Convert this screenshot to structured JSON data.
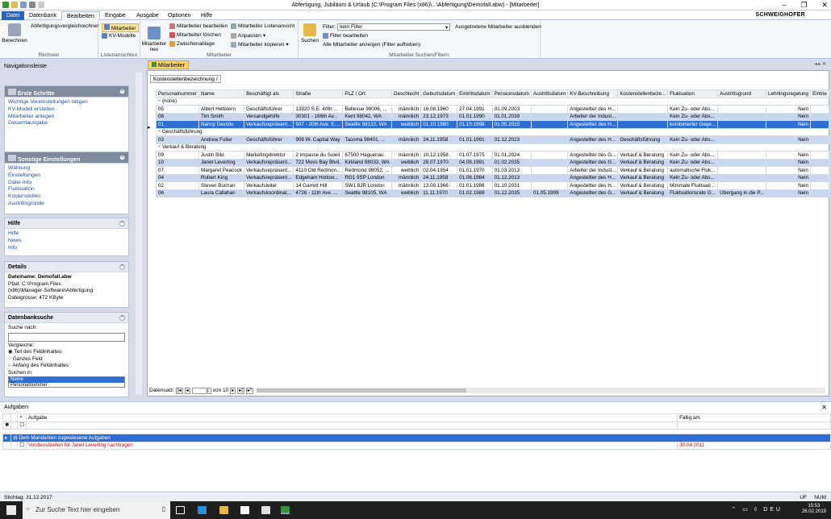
{
  "window": {
    "title": "Abfertigung, Jubiläum & Urlaub (C:\\Program Files (x86)\\...\\Abfertigung\\Demofall.abw) - [Mitarbeiter]",
    "brand": "SCHWEIGHOFER"
  },
  "menu": {
    "file": "Datei",
    "tabs": [
      "Datenbank",
      "Bearbeiten",
      "Eingabe",
      "Ausgabe",
      "Optionen",
      "Hilfe"
    ]
  },
  "ribbon": {
    "rechnen": {
      "abf": "Abfertigungsvergleichrechner",
      "btn": "Berechnen",
      "label": "Rechnen"
    },
    "listen": {
      "mitarbeiter": "Mitarbeiter",
      "kv": "KV-Modelle",
      "label": "Listenansichten"
    },
    "mitarbeiter": {
      "neu": "Mitarbeiter neu",
      "bearbeiten": "Mitarbeiter bearbeiten",
      "loeschen": "Mitarbeiter löschen",
      "zwischen": "Zwischenablage",
      "listenansicht": "Mitarbeiter Listenansicht",
      "anpassen": "Anpassen",
      "kopieren": "Mitarbeiter kopieren",
      "label": "Mitarbeiter"
    },
    "suchen": {
      "btn": "Suchen",
      "filter_label": "Filter:",
      "filter_value": "kein Filter",
      "ausblenden": "Ausgetretene Mitarbeiter ausblenden",
      "bearbeiten": "Filter bearbeiten",
      "alle": "Alle Mitarbeiter anzeigen (Filter aufheben)",
      "label": "Mitarbeiter Suchen/Filtern"
    }
  },
  "sidebar": {
    "title": "Navigationsleiste",
    "erste": {
      "title": "Erste Schritte",
      "links": [
        "Wichtige Voreinstellungen tätigen",
        "KV-Modell erstellen",
        "Mitarbeiter anlegen",
        "Gesamtausgabe"
      ]
    },
    "sonstige": {
      "title": "Sonstige Einstellungen",
      "links": [
        "Währung",
        "Einstellungen",
        "Datei-Info",
        "Fluktuation",
        "Kostenstellen",
        "Austrittsgründe"
      ]
    },
    "hilfe": {
      "title": "Hilfe",
      "links": [
        "Hilfe",
        "News",
        "Info"
      ]
    },
    "details": {
      "title": "Details",
      "name": "Dateiname: Demofall.abw",
      "pfad1": "Pfad: C:\\Program Files",
      "pfad2": "(x86)\\Manager-Software\\Abfertigung",
      "groesse": "Dateigrösse: 472 KByte"
    },
    "suche": {
      "title": "Datenbanksuche",
      "nach": "Suche nach:",
      "in_label": "Vergleiche:",
      "opt1": "Teil des Feldinhaltes",
      "opt2": "Ganzes Feld",
      "opt3": "Anfang des Feldinhaltes",
      "suchenin": "Suchen in:",
      "list1": "Name",
      "list2": "Personalnummer"
    }
  },
  "main": {
    "tab": "Mitarbeiter",
    "group_by": "Kostenstellenbezeichnung",
    "columns": [
      "Personalnummer",
      "Name",
      "Beschäftigt als",
      "Straße",
      "PLZ / Ort",
      "Geschlecht",
      "Geburtsdatum",
      "Eintrittsdatum",
      "Pensionsdatum",
      "Austrittsdatum",
      "KV-Beschreibung",
      "Kostenstellenbeze...",
      "Fluktuation",
      "Austrittsgrund",
      "Lehrlingsregelung",
      "Eintrie"
    ],
    "groups": [
      {
        "name": "(none)",
        "rows": [
          [
            "05",
            "Albert Hellstern",
            "Geschäftsführer",
            "13920 S.E. 40th ...",
            "Bellevue 98006, ...",
            "männlich",
            "16.08.1960",
            "27.04.1991",
            "01.09.2003",
            "",
            "Angestellter des H...",
            "",
            "Kein Zu- oder Abs...",
            "",
            "Nein",
            ""
          ],
          [
            "08",
            "Tim Smith",
            "Versandgehilfe",
            "30301 - 166th Av...",
            "Kent 98042, WA",
            "männlich",
            "23.12.1973",
            "01.01.1990",
            "01.01.2039",
            "",
            "Arbeiter der Indust...",
            "",
            "Kein Zu- oder Abs...",
            "",
            "Nein",
            ""
          ],
          [
            "01",
            "Nancy Davolio",
            "Verkaufsrepräsent...",
            "507 - 20th Ave. E....",
            "Seattle 98122, WA",
            "weiblich",
            "01.10.1980",
            "01.10.1996",
            "01.05.2015",
            "",
            "Angestellter des H...",
            "",
            "kombinierter Gege...",
            "",
            "Nein",
            ""
          ]
        ]
      },
      {
        "name": "Geschäftsführung",
        "rows": [
          [
            "03",
            "Andrew Fuller",
            "Geschäftsführer",
            "908 W. Capital Way",
            "Tacoma 98401, ...",
            "männlich",
            "24.11.1958",
            "01.01.1991",
            "01.12.2023",
            "",
            "Angestellter des H...",
            "Geschäftsführung",
            "Kein Zu- oder Abs...",
            "",
            "Nein",
            ""
          ]
        ]
      },
      {
        "name": "Verkauf & Beratung",
        "rows": [
          [
            "09",
            "Justin Bild",
            "Marketingdirektor",
            "2 impasse du Soleil",
            "67500 Haguenau",
            "männlich",
            "10.12.1958",
            "01.07.1975",
            "01.01.2024",
            "",
            "Angestellter des G...",
            "Verkauf & Beratung",
            "Kein Zu- oder Abs...",
            "",
            "Nein",
            ""
          ],
          [
            "10",
            "Janet Leverling",
            "Verkaufsrepräsent...",
            "722 Moss Bay Blvd.",
            "Kirkland 98033, WA",
            "weiblich",
            "28.07.1970",
            "04.08.1991",
            "01.02.2035",
            "",
            "Angestellter des G...",
            "Verkauf & Beratung",
            "Kein Zu- oder Abs...",
            "",
            "Nein",
            ""
          ],
          [
            "07",
            "Margaret Peacock",
            "Verkaufsrepräsent...",
            "4110 Old Redmon...",
            "Redmond 98052, ...",
            "weiblich",
            "02.04.1954",
            "01.01.1970",
            "01.03.2013",
            "",
            "Arbeiter der Indust...",
            "Verkauf & Beratung",
            "automatische Fluk...",
            "",
            "Nein",
            ""
          ],
          [
            "04",
            "Robert King",
            "Verkaufsrepräsent...",
            "Edgeham Hollow...",
            "RG1 9SP London",
            "männlich",
            "24.11.1958",
            "01.06.1984",
            "01.12.2013",
            "",
            "Angestellter des H...",
            "Verkauf & Beratung",
            "Kein Zu- oder Abs...",
            "",
            "Nein",
            ""
          ],
          [
            "02",
            "Steven Buchan",
            "Verkaufsleiter",
            "14 Garrett Hill",
            "SW1 8JR London",
            "männlich",
            "13.09.1966",
            "01.01.1986",
            "01.10.2031",
            "",
            "Angestellter des H...",
            "Verkauf & Beratung",
            "Minimale Fluktuati...",
            "",
            "Nein",
            ""
          ],
          [
            "06",
            "Laura Callahan",
            "Verkaufskoordinat...",
            "4726 - 11th Ave. ...",
            "Seattle 98105, WA",
            "weiblich",
            "11.11.1970",
            "01.02.1988",
            "01.12.2035",
            "01.05.1999",
            "Angestellter des G...",
            "Verkauf & Beratung",
            "Fluktuationsrate G...",
            "Übergang in die P...",
            "Nein",
            ""
          ]
        ]
      }
    ],
    "nav": {
      "label": "Datensatz:",
      "current": "3",
      "of": "von 10"
    }
  },
  "tasks": {
    "title": "Aufgaben",
    "col_task": "Aufgabe",
    "col_due": "Fällig am",
    "group": "Dem Mandanten zugewiesene Aufgaben",
    "item": "Vordienstzeiten für Janet Leverling nachtragen",
    "item_due": "30.04.2011"
  },
  "status": {
    "left": "Stichtag: 31.12.2017",
    "right1": "UF",
    "right2": "NUM"
  },
  "taskbar": {
    "search": "Zur Suche Text hier eingeben",
    "time": "15:53",
    "date": "26.02.2019"
  }
}
